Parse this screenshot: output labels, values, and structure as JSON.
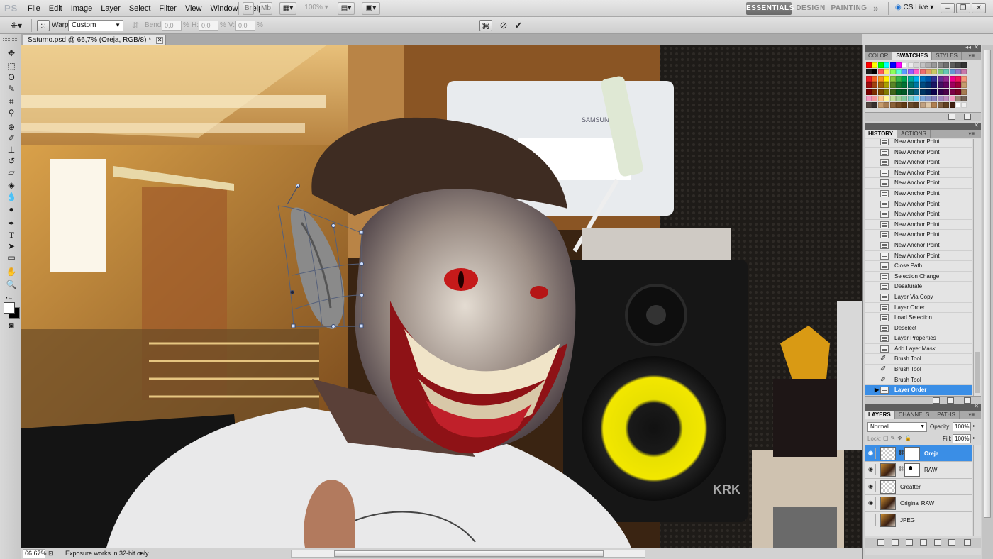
{
  "app": {
    "logo": "PS",
    "menus": [
      "File",
      "Edit",
      "Image",
      "Layer",
      "Select",
      "Filter",
      "View",
      "Window",
      "Help"
    ],
    "zoom_menu": "100%",
    "workspaces": [
      "ESSENTIALS",
      "DESIGN",
      "PAINTING"
    ],
    "active_workspace": "ESSENTIALS",
    "more_workspaces": "»",
    "cs_live": "CS Live"
  },
  "options_bar": {
    "warp_label": "Warp:",
    "warp_value": "Custom",
    "bend_label": "Bend:",
    "bend_value": "0,0",
    "bend_unit": "%",
    "h_label": "H:",
    "h_value": "0,0",
    "h_unit": "%",
    "v_label": "V:",
    "v_value": "0,0",
    "v_unit": "%"
  },
  "document": {
    "tab_title": "Saturno.psd @ 66,7% (Oreja, RGB/8) *"
  },
  "status": {
    "zoom": "66,67%",
    "info": "Exposure works in 32-bit only"
  },
  "panels": {
    "color": {
      "tabs": [
        "COLOR",
        "SWATCHES",
        "STYLES"
      ],
      "active": "SWATCHES",
      "swatch_rows": [
        [
          "#ff0000",
          "#ffff00",
          "#00ff00",
          "#00ffff",
          "#0000ff",
          "#ff00ff",
          "#ffffff",
          "#ebebeb",
          "#d6d6d6",
          "#c2c2c2",
          "#adadad",
          "#999999",
          "#858585",
          "#707070",
          "#5c5c5c",
          "#474747",
          "#333333"
        ],
        [
          "#1e1e1e",
          "#000000",
          "#ff5a5a",
          "#fff05a",
          "#8cff5a",
          "#5affd2",
          "#5a9bff",
          "#965aff",
          "#ff5ac8",
          "#f06e6e",
          "#e6a064",
          "#c8c864",
          "#78c878",
          "#64c8b4",
          "#6496d2",
          "#9678c8",
          "#c878aa"
        ],
        [
          "#ed1c24",
          "#f26522",
          "#f7941d",
          "#fff200",
          "#8dc63f",
          "#39b54a",
          "#00a651",
          "#00a99d",
          "#00aeef",
          "#0072bc",
          "#0054a6",
          "#2e3192",
          "#662d91",
          "#92278f",
          "#ec008c",
          "#ed145b",
          "#f69679"
        ],
        [
          "#9e0b0f",
          "#a0410d",
          "#a36209",
          "#aba000",
          "#598527",
          "#197b30",
          "#007236",
          "#00746b",
          "#0076a3",
          "#004a80",
          "#003471",
          "#1b1464",
          "#440e62",
          "#630460",
          "#9e005d",
          "#9e0039",
          "#c69c6d"
        ],
        [
          "#790000",
          "#7b2e00",
          "#7d4900",
          "#827b00",
          "#406618",
          "#005e20",
          "#005826",
          "#005952",
          "#005b7f",
          "#003663",
          "#002157",
          "#0d004c",
          "#32004b",
          "#4b0049",
          "#7b0046",
          "#7a0026",
          "#a67c52"
        ],
        [
          "#f49ac1",
          "#f5989d",
          "#fdc689",
          "#fff799",
          "#c4df9b",
          "#a3d39c",
          "#82ca9d",
          "#7accc8",
          "#6dcff6",
          "#7da7d9",
          "#8393ca",
          "#8781bd",
          "#a186be",
          "#bd8cbf",
          "#f49ac2",
          "#998675",
          "#736357"
        ],
        [
          "#534741",
          "#362f2d",
          "#c69c6d",
          "#a67c52",
          "#8c6239",
          "#754c24",
          "#603913",
          "#6b4b2a",
          "#5a3c1e",
          "#c0a080",
          "#e0c8a8",
          "#b08050",
          "#806040",
          "#604020",
          "#402010",
          "#ffffff",
          "#f0f0f0"
        ]
      ]
    },
    "history": {
      "tabs": [
        "HISTORY",
        "ACTIONS"
      ],
      "active": "HISTORY",
      "items": [
        {
          "label": "New Anchor Point",
          "icon": "doc"
        },
        {
          "label": "New Anchor Point",
          "icon": "doc"
        },
        {
          "label": "New Anchor Point",
          "icon": "doc"
        },
        {
          "label": "New Anchor Point",
          "icon": "doc"
        },
        {
          "label": "New Anchor Point",
          "icon": "doc"
        },
        {
          "label": "New Anchor Point",
          "icon": "doc"
        },
        {
          "label": "New Anchor Point",
          "icon": "doc"
        },
        {
          "label": "New Anchor Point",
          "icon": "doc"
        },
        {
          "label": "New Anchor Point",
          "icon": "doc"
        },
        {
          "label": "New Anchor Point",
          "icon": "doc"
        },
        {
          "label": "New Anchor Point",
          "icon": "doc"
        },
        {
          "label": "New Anchor Point",
          "icon": "doc"
        },
        {
          "label": "Close Path",
          "icon": "doc"
        },
        {
          "label": "Selection Change",
          "icon": "doc"
        },
        {
          "label": "Desaturate",
          "icon": "doc"
        },
        {
          "label": "Layer Via Copy",
          "icon": "doc"
        },
        {
          "label": "Layer Order",
          "icon": "doc"
        },
        {
          "label": "Load Selection",
          "icon": "doc"
        },
        {
          "label": "Deselect",
          "icon": "doc"
        },
        {
          "label": "Layer Properties",
          "icon": "doc"
        },
        {
          "label": "Add Layer Mask",
          "icon": "doc"
        },
        {
          "label": "Brush Tool",
          "icon": "brush"
        },
        {
          "label": "Brush Tool",
          "icon": "brush"
        },
        {
          "label": "Brush Tool",
          "icon": "brush"
        },
        {
          "label": "Layer Order",
          "icon": "doc",
          "selected": true
        }
      ]
    },
    "layers": {
      "tabs": [
        "LAYERS",
        "CHANNELS",
        "PATHS"
      ],
      "active": "LAYERS",
      "blend_mode": "Normal",
      "opacity_label": "Opacity:",
      "opacity": "100%",
      "lock_label": "Lock:",
      "fill_label": "Fill:",
      "fill": "100%",
      "items": [
        {
          "name": "Oreja",
          "visible": true,
          "thumb": "checker",
          "mask": true,
          "selected": true
        },
        {
          "name": "RAW",
          "visible": true,
          "thumb": "photo",
          "mask": true,
          "maskspot": true
        },
        {
          "name": "Creatter",
          "visible": true,
          "thumb": "checker"
        },
        {
          "name": "Original RAW",
          "visible": true,
          "thumb": "photo"
        },
        {
          "name": "JPEG",
          "visible": false,
          "thumb": "photo"
        }
      ]
    }
  }
}
